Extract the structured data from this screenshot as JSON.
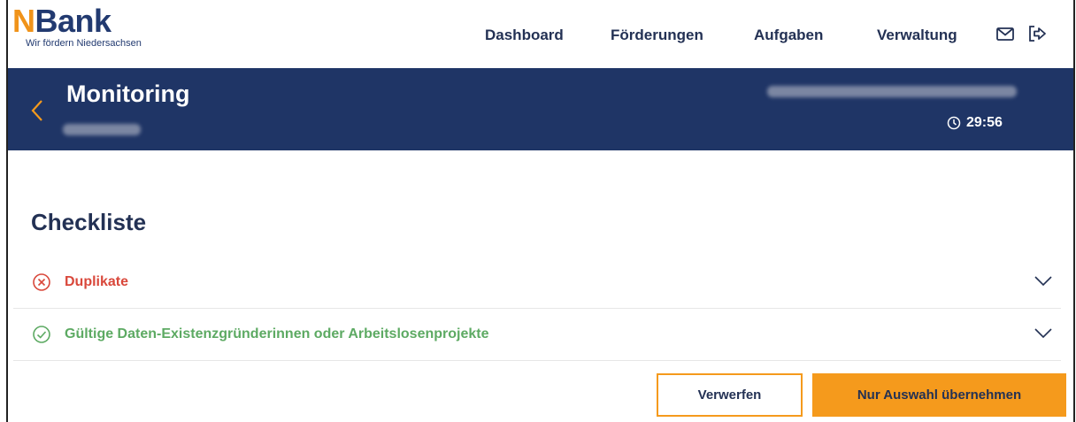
{
  "header": {
    "logo_accent": "N",
    "logo_main": "Bank",
    "logo_tagline": "Wir fördern Niedersachsen",
    "nav": [
      "Dashboard",
      "Förderungen",
      "Aufgaben",
      "Verwaltung"
    ],
    "icons": [
      "mail-icon",
      "logout-icon"
    ]
  },
  "banner": {
    "title": "Monitoring",
    "timer": "29:56",
    "back_icon": "chevron-left-icon",
    "timer_icon": "clock-icon"
  },
  "checklist": {
    "title": "Checkliste",
    "items": [
      {
        "label": "Duplikate",
        "status": "error",
        "icon": "x-circle-icon"
      },
      {
        "label": "Gültige Daten-Existenzgründerinnen oder Arbeitslosenprojekte",
        "status": "ok",
        "icon": "check-circle-icon"
      }
    ]
  },
  "actions": {
    "discard": "Verwerfen",
    "apply_selection": "Nur Auswahl übernehmen"
  },
  "colors": {
    "navy": "#1f3566",
    "orange": "#f59a1c",
    "error": "#d9483b",
    "success": "#5daa63"
  }
}
